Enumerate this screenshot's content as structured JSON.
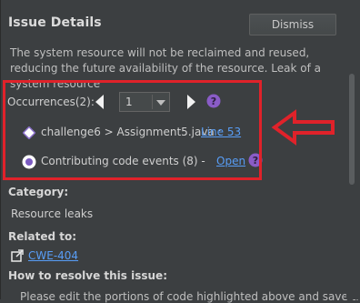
{
  "panel": {
    "title": "Issue Details",
    "dismiss_label": "Dismiss",
    "description": "The system resource will not be reclaimed and reused, reducing the future availability of the resource. Leak of a system resource"
  },
  "occurrences": {
    "label": "Occurrences(2):",
    "selected": "1",
    "trace_path": "challenge6 > Assignment5.java :",
    "line_link": "Line 53",
    "contributing_text": "Contributing code events (8) -",
    "open_link": "Open"
  },
  "category": {
    "label": "Category:",
    "value": "Resource leaks"
  },
  "related": {
    "label": "Related to:",
    "link": "CWE-404"
  },
  "resolve": {
    "label": "How to resolve this issue:",
    "text_cut": "Please edit the portions of code highlighted above and save the"
  },
  "colors": {
    "background": "#3c3f41",
    "link": "#589df6",
    "annotation_red": "#e0222a",
    "help_purple": "#8a5cc7"
  },
  "icons": {
    "prev": "triangle-left-icon",
    "next": "triangle-right-icon",
    "help": "help-circle-icon",
    "trace": "diamond-icon",
    "contributing": "radio-dot-icon",
    "external": "external-link-icon",
    "annotation": "red-outline-arrow"
  }
}
